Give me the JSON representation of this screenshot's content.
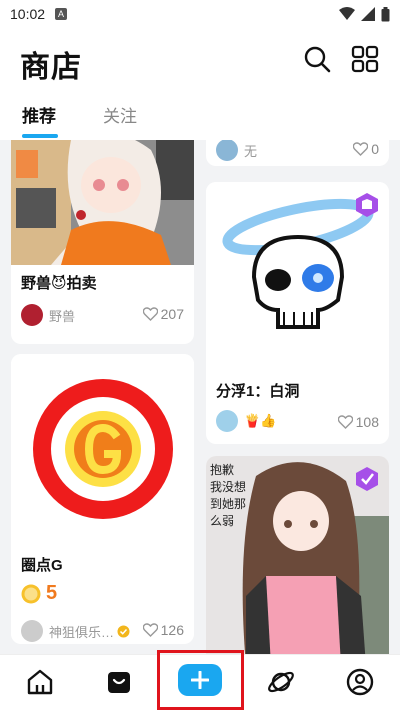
{
  "status": {
    "time": "10:02",
    "a_icon": "A"
  },
  "header": {
    "title": "商店"
  },
  "tabs": [
    {
      "label": "推荐"
    },
    {
      "label": "关注"
    }
  ],
  "cards": {
    "c1": {
      "name": "野兽😈拍卖",
      "author": "野兽",
      "likes": "207"
    },
    "c2": {
      "author": "无",
      "likes": "0"
    },
    "c3": {
      "name": "分浮1：白洞",
      "author": "🍟👍",
      "likes": "108"
    },
    "c4": {
      "name": "圈点G",
      "price": "5",
      "author": "神狙俱乐…",
      "likes": "126"
    },
    "c5": {
      "art_text": "抱歉\n我没想\n到她那\n么弱"
    }
  },
  "nav": {
    "items": [
      "home-icon",
      "bag-icon",
      "add-icon",
      "planet-icon",
      "profile-icon"
    ]
  },
  "colors": {
    "accent": "#1aa7f0",
    "highlight": "#e0141c"
  }
}
